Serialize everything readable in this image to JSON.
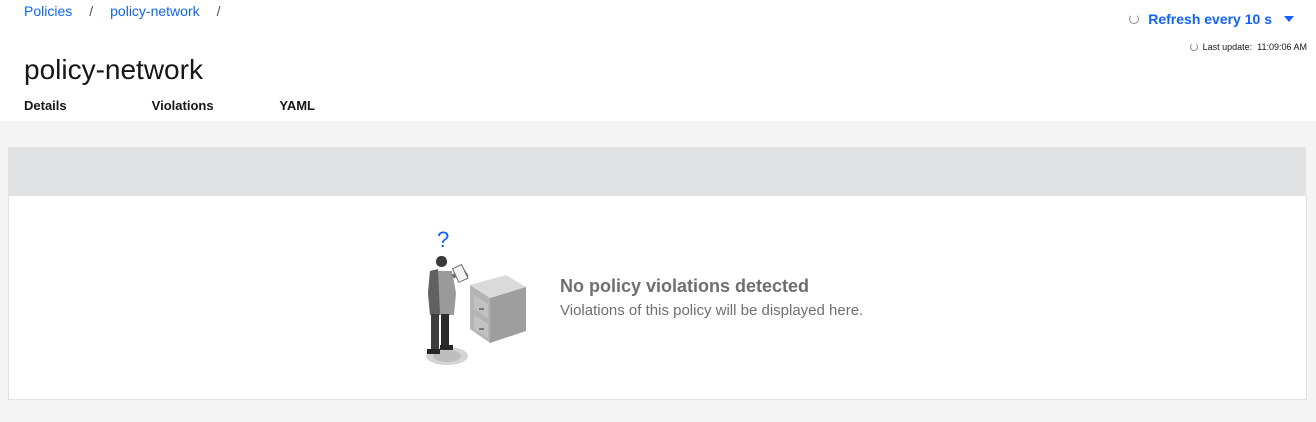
{
  "breadcrumb": {
    "items": [
      "Policies",
      "policy-network"
    ],
    "separator": "/"
  },
  "page_title": "policy-network",
  "refresh": {
    "label": "Refresh every 10 s",
    "last_update_label": "Last update:",
    "last_update_time": "11:09:06 AM"
  },
  "tabs": [
    {
      "label": "Details",
      "active": false
    },
    {
      "label": "Violations",
      "active": true
    },
    {
      "label": "YAML",
      "active": false
    }
  ],
  "empty_state": {
    "question_mark": "?",
    "title": "No policy violations detected",
    "description": "Violations of this policy will be displayed here."
  },
  "colors": {
    "accent": "#0f62fe",
    "muted_text": "#6f6f6f",
    "panel_header": "#e0e1e3",
    "canvas": "#f4f4f4"
  },
  "icons": {
    "refresh": "refresh-spinner-icon",
    "caret": "caret-down-icon",
    "illustration": "person-with-file-cabinet-illustration"
  }
}
